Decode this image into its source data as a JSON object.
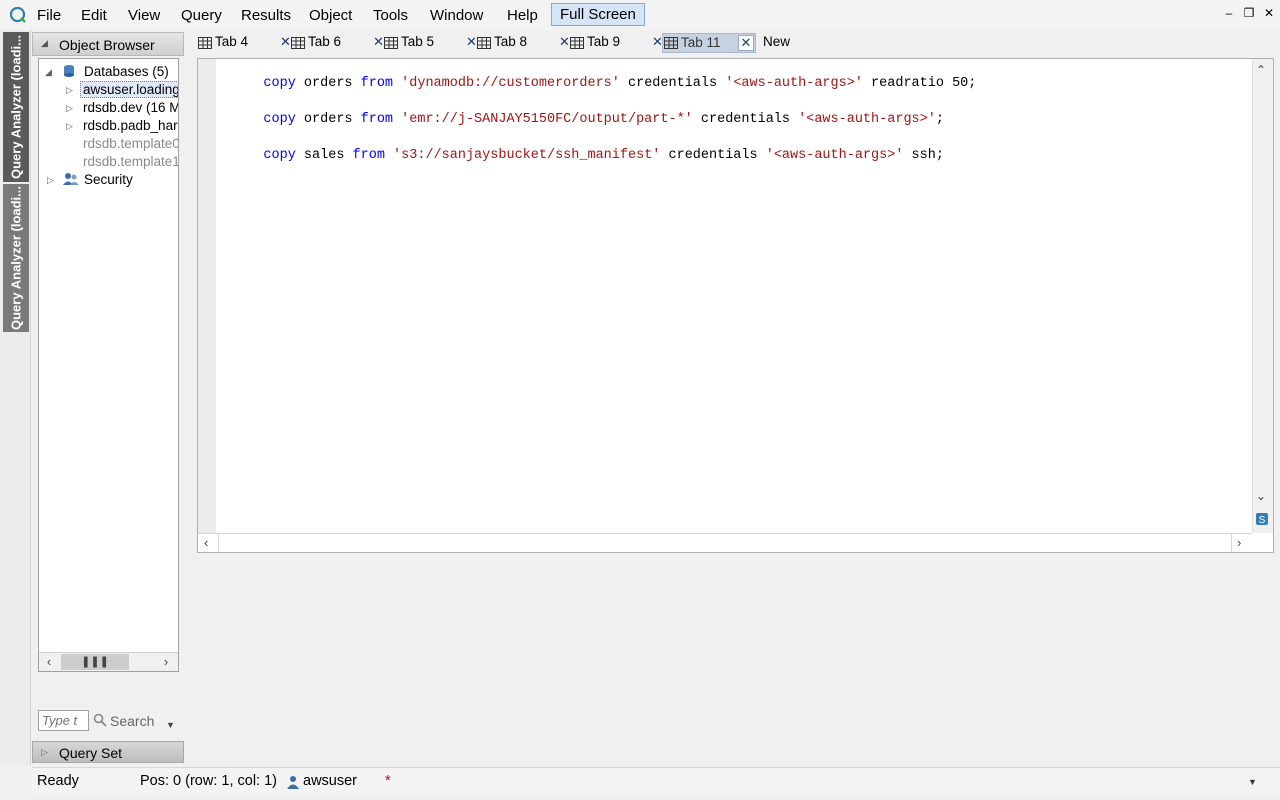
{
  "menubar": {
    "items": [
      "File",
      "Edit",
      "View",
      "Query",
      "Results",
      "Object",
      "Tools",
      "Window",
      "Help"
    ],
    "full_screen": "Full Screen"
  },
  "left_strip": {
    "tab1": "Query Analyzer (loadi...",
    "tab2": "Query Analyzer (loadi..."
  },
  "object_browser": {
    "title": "Object Browser",
    "tree": {
      "databases": "Databases (5)",
      "items": [
        "awsuser.loading",
        "rdsdb.dev (16 M",
        "rdsdb.padb_har",
        "rdsdb.template0",
        "rdsdb.template1"
      ],
      "security": "Security"
    },
    "search_placeholder": "Type t",
    "search_label": "Search",
    "query_set": "Query Set"
  },
  "tabs": {
    "items": [
      "Tab 4",
      "Tab 6",
      "Tab 5",
      "Tab 8",
      "Tab 9",
      "Tab 11"
    ],
    "active": "Tab 11",
    "new_label": "New"
  },
  "editor": {
    "lines": [
      [
        "copy",
        " orders ",
        "from",
        " ",
        "'dynamodb://customerorders'",
        " credentials ",
        "'<aws-auth-args>'",
        " readratio 50;"
      ],
      [
        "copy",
        " orders ",
        "from",
        " ",
        "'emr://j-SANJAY5150FC/output/part-*'",
        " credentials ",
        "'<aws-auth-args>'",
        ";"
      ],
      [
        "copy",
        " sales ",
        "from",
        " ",
        "'s3://sanjaysbucket/ssh_manifest'",
        " credentials ",
        "'<aws-auth-args>'",
        " ssh;"
      ]
    ]
  },
  "statusbar": {
    "state": "Ready",
    "position": "Pos: 0 (row: 1, col: 1)",
    "user": "awsuser",
    "dirty": "*"
  },
  "colors": {
    "keyword": "#0000ff",
    "string": "#a31515",
    "active_tab": "#c6d2e2",
    "full_screen_bg": "#d6e4f7"
  }
}
